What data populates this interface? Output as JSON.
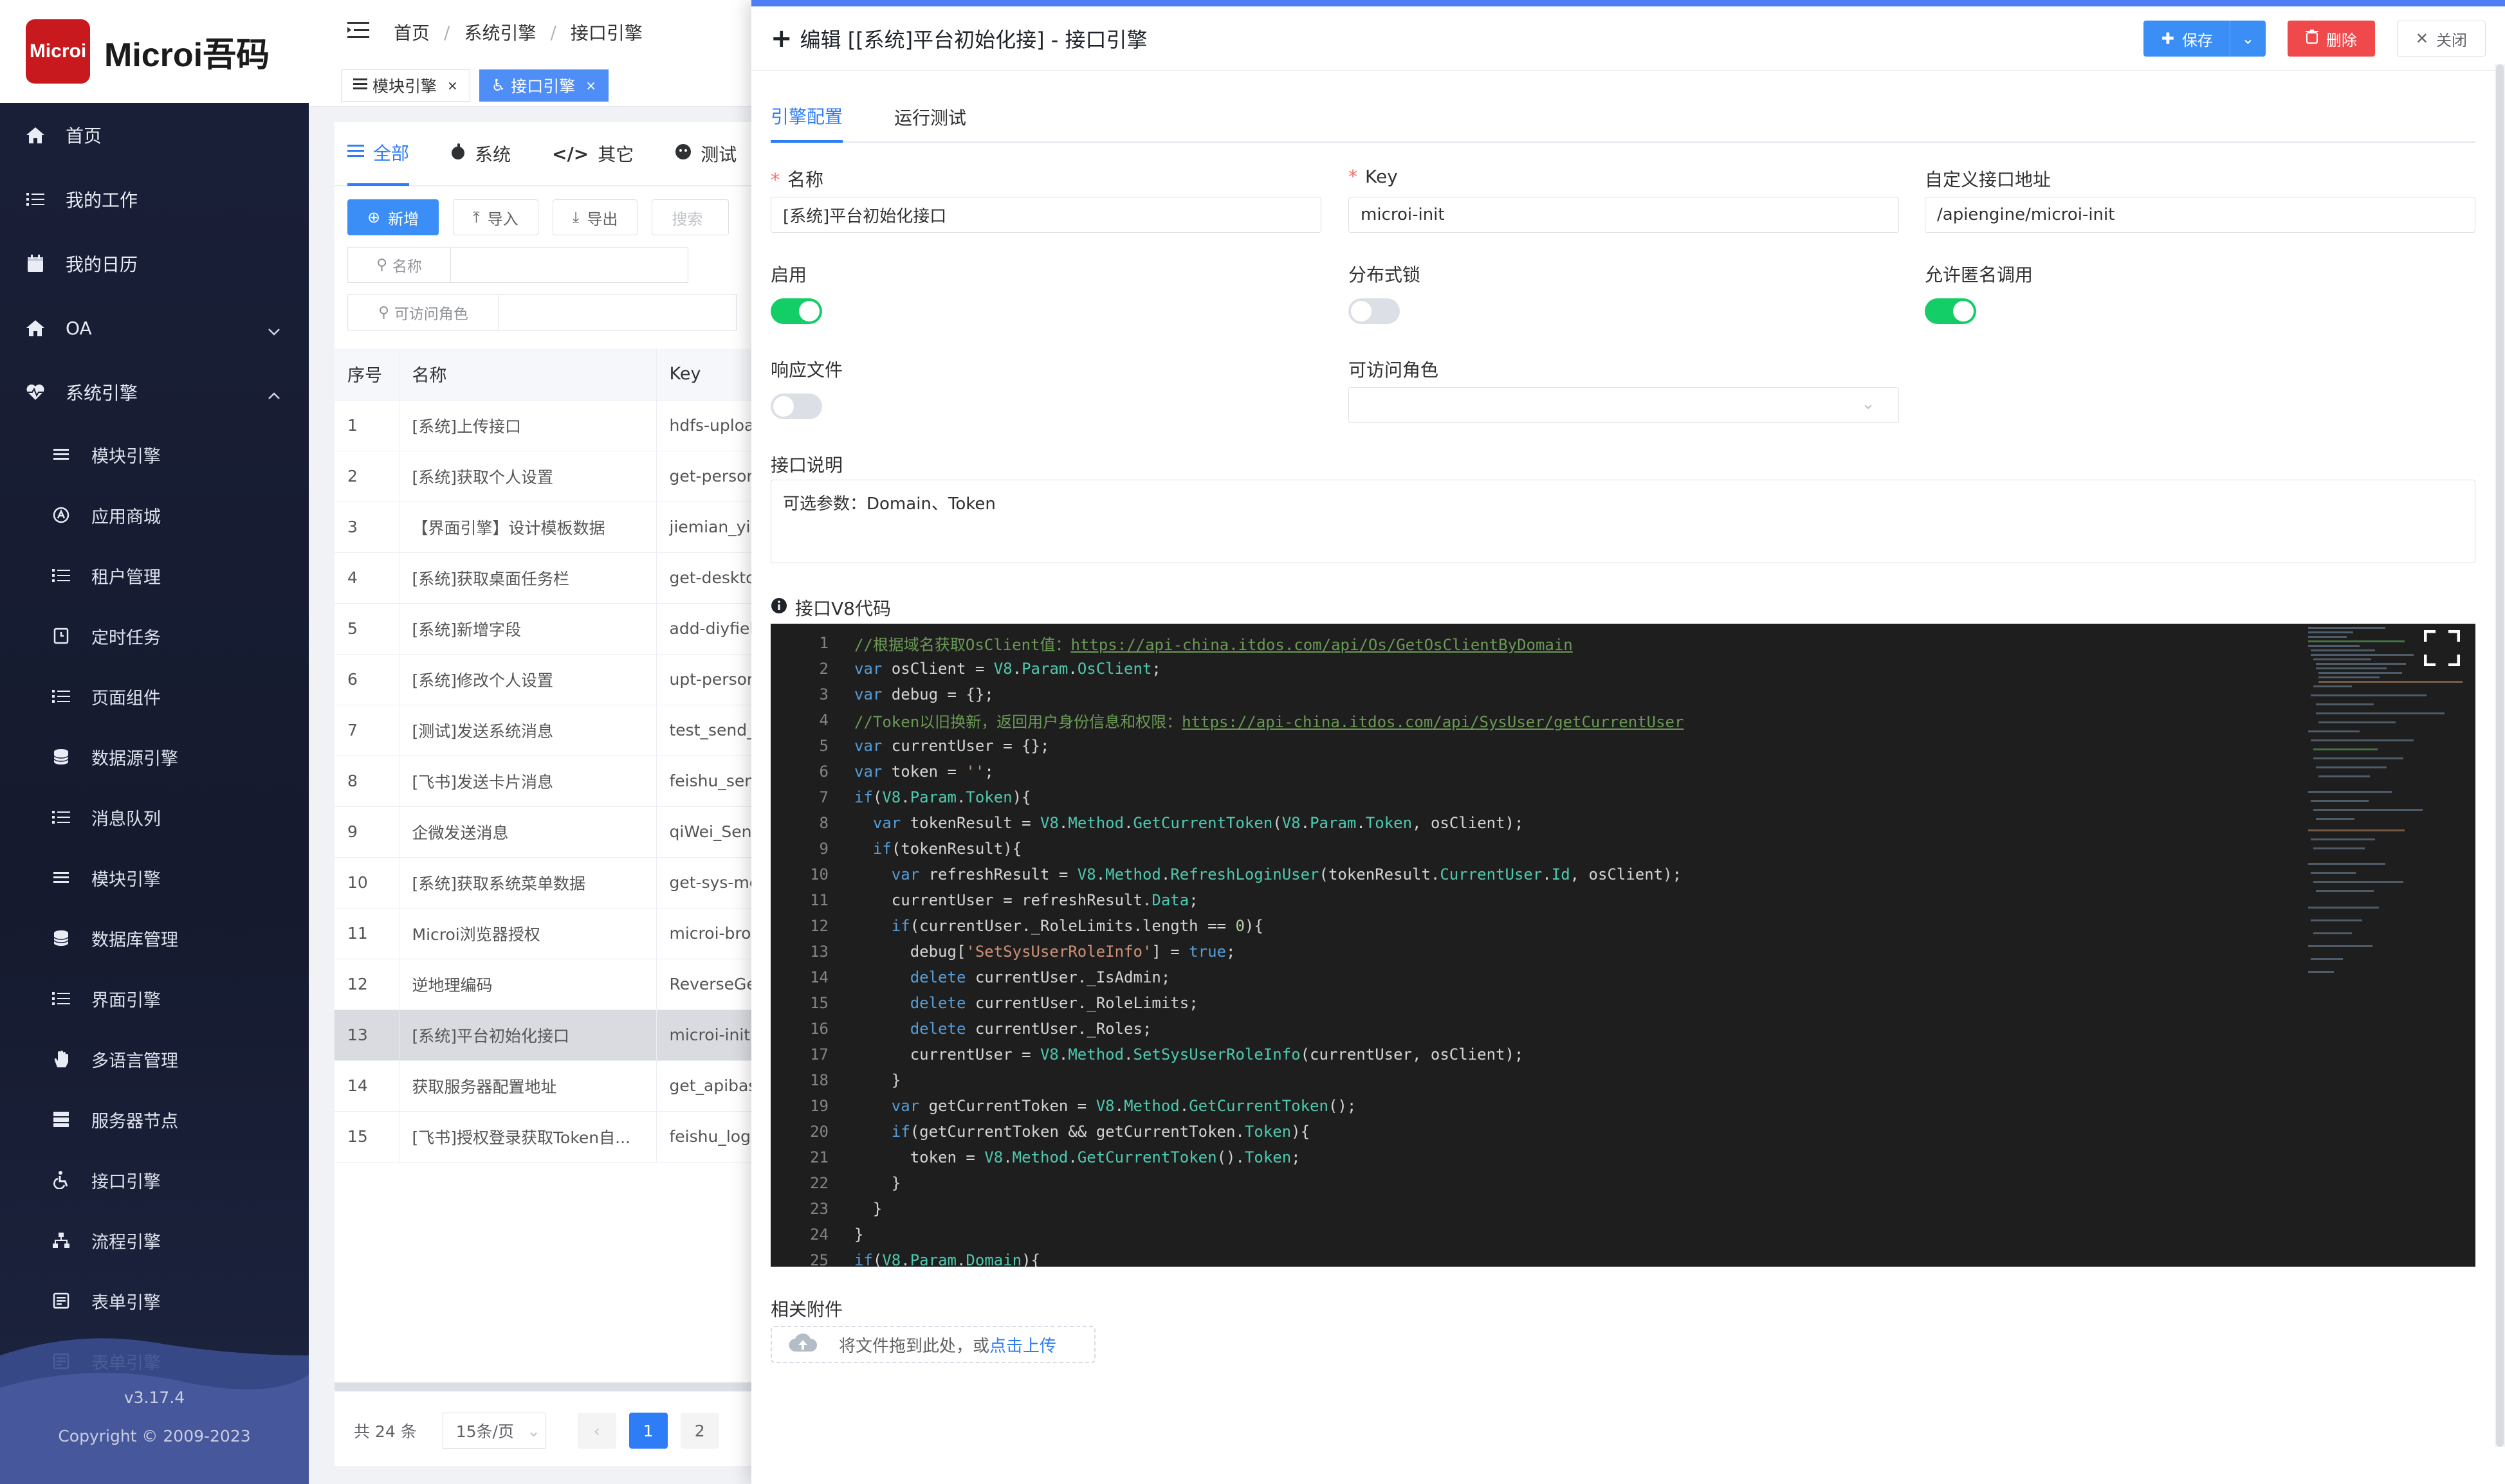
{
  "brand": {
    "logo_badge": "Microi",
    "logo_text": "Microi吾码",
    "accent": "#c8191e"
  },
  "sidebar": {
    "top_items": [
      {
        "label": "首页",
        "icon": "home-icon"
      },
      {
        "label": "我的工作",
        "icon": "list-icon"
      },
      {
        "label": "我的日历",
        "icon": "calendar-icon"
      },
      {
        "label": "OA",
        "icon": "home-icon",
        "expand": "down"
      },
      {
        "label": "系统引擎",
        "icon": "heart-icon",
        "expand": "up"
      }
    ],
    "sub_items": [
      {
        "label": "模块引擎",
        "icon": "menu-icon"
      },
      {
        "label": "应用商城",
        "icon": "store-icon"
      },
      {
        "label": "租户管理",
        "icon": "list-icon"
      },
      {
        "label": "定时任务",
        "icon": "clock-icon"
      },
      {
        "label": "页面组件",
        "icon": "list-icon"
      },
      {
        "label": "数据源引擎",
        "icon": "database-icon"
      },
      {
        "label": "消息队列",
        "icon": "list-icon"
      },
      {
        "label": "模块引擎",
        "icon": "menu-icon"
      },
      {
        "label": "数据库管理",
        "icon": "database-icon"
      },
      {
        "label": "界面引擎",
        "icon": "list-icon"
      },
      {
        "label": "多语言管理",
        "icon": "hand-icon"
      },
      {
        "label": "服务器节点",
        "icon": "server-icon"
      },
      {
        "label": "接口引擎",
        "icon": "accessibility-icon"
      },
      {
        "label": "流程引擎",
        "icon": "sitemap-icon"
      },
      {
        "label": "表单引擎",
        "icon": "form-icon"
      },
      {
        "label": "表单引擎",
        "icon": "form-icon"
      }
    ],
    "version": "v3.17.4",
    "copyright": "Copyright © 2009-2023"
  },
  "topbar": {
    "breadcrumbs": [
      "首页",
      "系统引擎",
      "接口引擎"
    ]
  },
  "tags": [
    {
      "label": "模块引擎",
      "active": false
    },
    {
      "label": "接口引擎",
      "active": true
    }
  ],
  "list": {
    "tabs": [
      "全部",
      "系统",
      "其它",
      "测试"
    ],
    "buttons": {
      "add": "新增",
      "import": "导入",
      "export": "导出"
    },
    "search_placeholder": "搜索",
    "filter_name": "名称",
    "filter_role": "可访问角色",
    "columns": [
      "序号",
      "名称",
      "Key"
    ],
    "rows": [
      [
        "1",
        "[系统]上传接口",
        "hdfs-upload"
      ],
      [
        "2",
        "[系统]获取个人设置",
        "get-personal"
      ],
      [
        "3",
        "【界面引擎】设计模板数据",
        "jiemian_yinqing"
      ],
      [
        "4",
        "[系统]获取桌面任务栏",
        "get-desktop"
      ],
      [
        "5",
        "[系统]新增字段",
        "add-diyfield"
      ],
      [
        "6",
        "[系统]修改个人设置",
        "upt-personal"
      ],
      [
        "7",
        "[测试]发送系统消息",
        "test_send_msg"
      ],
      [
        "8",
        "[飞书]发送卡片消息",
        "feishu_send"
      ],
      [
        "9",
        "企微发送消息",
        "qiWei_Send"
      ],
      [
        "10",
        "[系统]获取系统菜单数据",
        "get-sys-menu"
      ],
      [
        "11",
        "Microi浏览器授权",
        "microi-browser"
      ],
      [
        "12",
        "逆地理编码",
        "ReverseGeo"
      ],
      [
        "13",
        "[系统]平台初始化接口",
        "microi-init"
      ],
      [
        "14",
        "获取服务器配置地址",
        "get_apibase"
      ],
      [
        "15",
        "[飞书]授权登录获取Token自...",
        "feishu_login"
      ]
    ],
    "selected_row": 12,
    "total": "共 24 条",
    "page_size": "15条/页",
    "pages": [
      "1",
      "2"
    ]
  },
  "drawer": {
    "title": "编辑 [[系统]平台初始化接] - 接口引擎",
    "buttons": {
      "save": "保存",
      "delete": "删除",
      "close": "关闭"
    },
    "tabs": [
      "引擎配置",
      "运行测试"
    ],
    "fields": {
      "name_label": "名称",
      "name_value": "[系统]平台初始化接口",
      "key_label": "Key",
      "key_value": "microi-init",
      "url_label": "自定义接口地址",
      "url_value": "/apiengine/microi-init",
      "enable_label": "启用",
      "enable_on": true,
      "lock_label": "分布式锁",
      "lock_on": false,
      "anon_label": "允许匿名调用",
      "anon_on": true,
      "resp_label": "响应文件",
      "resp_on": false,
      "role_label": "可访问角色",
      "desc_label": "接口说明",
      "desc_value": "可选参数：Domain、Token",
      "code_label": "接口V8代码",
      "attach_label": "相关附件",
      "upload_text": "将文件拖到此处，或",
      "upload_link": "点击上传"
    }
  }
}
